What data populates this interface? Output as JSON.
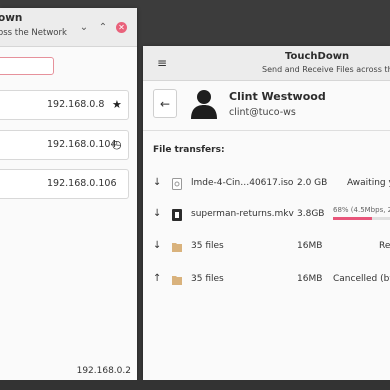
{
  "back_window": {
    "title": "own",
    "subtitle": "oss the Network",
    "controls": {
      "minimize": "⌄",
      "maximize": "⌃",
      "close": "✕"
    },
    "filter_placeholder": "",
    "devices": [
      {
        "ip": "192.168.0.8",
        "icon": "star-icon",
        "glyph": "★"
      },
      {
        "ip": "192.168.0.104",
        "icon": "clock-icon",
        "glyph": "◷"
      },
      {
        "ip": "192.168.0.106",
        "icon": "",
        "glyph": ""
      }
    ],
    "footer_ip": "192.168.0.2"
  },
  "front_window": {
    "menu_glyph": "≡",
    "title": "TouchDown",
    "subtitle": "Send and Receive Files across the N",
    "back_glyph": "←",
    "contact": {
      "name": "Clint Westwood",
      "address": "clint@tuco-ws"
    },
    "transfers_label": "File transfers:",
    "transfers": [
      {
        "direction_glyph": "↓",
        "icon": "disk-image-icon",
        "name": "lmde-4-Cin…40617.iso",
        "size": "2.0 GB",
        "status": "Awaiting y"
      },
      {
        "direction_glyph": "↓",
        "icon": "video-icon",
        "name": "superman-returns.mkv",
        "size": "3.8GB",
        "status": "68% (4.5Mbps, 2",
        "progress": 0.68
      },
      {
        "direction_glyph": "↓",
        "icon": "folder-icon",
        "name": "35 files",
        "size": "16MB",
        "status": "Re"
      },
      {
        "direction_glyph": "↑",
        "icon": "folder-icon",
        "name": "35 files",
        "size": "16MB",
        "status": "Cancelled (by"
      }
    ]
  },
  "colors": {
    "accent": "#e8557a",
    "close_button": "#e9627b",
    "folder": "#d9b27c"
  }
}
